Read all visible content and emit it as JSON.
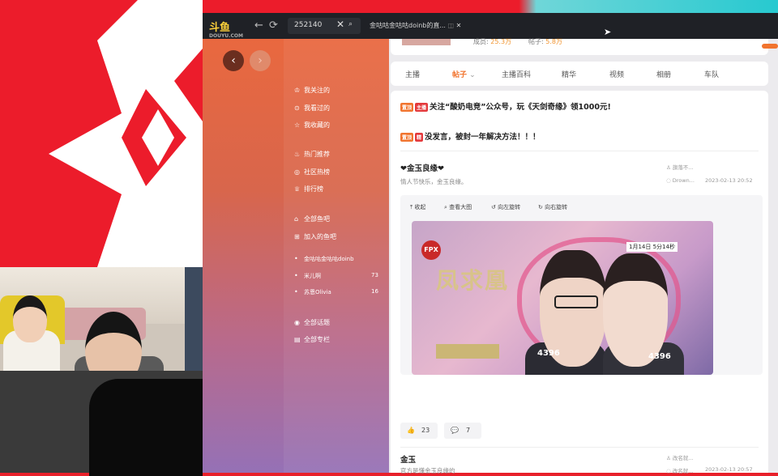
{
  "titlebar": {
    "logo": "斗鱼",
    "logo_sub": "DOUYU.COM",
    "back_icon": "←",
    "reload_icon": "⟳",
    "search_value": "252140",
    "clear_icon": "✕",
    "search_icon": "⌕",
    "tab_title": "金咕咕金咕咕doinb的直...",
    "tab_close_icon": "✕"
  },
  "stats": {
    "fans_label": "成员:",
    "fans_value": "25.3万",
    "posts_label": "帖子:",
    "posts_value": "5.8万"
  },
  "sidebar": {
    "back_arrow": "‹",
    "forward_arrow": "›",
    "items": [
      {
        "icon": "♔",
        "label": "我关注的"
      },
      {
        "icon": "⊙",
        "label": "我看过的"
      },
      {
        "icon": "☆",
        "label": "我收藏的"
      },
      {
        "icon": "♨",
        "label": "热门推荐"
      },
      {
        "icon": "◎",
        "label": "社区热榜"
      },
      {
        "icon": "♕",
        "label": "排行榜"
      },
      {
        "icon": "⌂",
        "label": "全部鱼吧"
      },
      {
        "icon": "⊞",
        "label": "加入的鱼吧"
      },
      {
        "icon": "•",
        "label": "金咕咕金咕咕doinb",
        "count": ""
      },
      {
        "icon": "•",
        "label": "米儿啊",
        "count": "73"
      },
      {
        "icon": "•",
        "label": "苏恩Olivia",
        "count": "16"
      },
      {
        "icon": "◉",
        "label": "全部话题"
      },
      {
        "icon": "▤",
        "label": "全部专栏"
      }
    ]
  },
  "tabs": [
    {
      "label": "主播"
    },
    {
      "label": "帖子"
    },
    {
      "label": "主播百科"
    },
    {
      "label": "精华"
    },
    {
      "label": "视频"
    },
    {
      "label": "相册"
    },
    {
      "label": "车队"
    }
  ],
  "tab_chevron": "⌄",
  "pinned": [
    {
      "badges": [
        "置顶",
        "主播"
      ],
      "title": "关注“酸奶电竞”公众号，玩《天剑奇缘》领1000元!"
    },
    {
      "badges": [
        "置顶",
        "精"
      ],
      "title": "没发言，被封一年解决方法！！！"
    }
  ],
  "post1": {
    "title": "❤金玉良缘❤",
    "subtitle": "情人节快乐，金玉良缘。",
    "author": "旗落不...",
    "replier": "Drown...",
    "time": "2023-02-13 20:52",
    "viewer_tools": [
      {
        "icon": "⤒",
        "label": "收起"
      },
      {
        "icon": "⌕",
        "label": "查看大图"
      },
      {
        "icon": "↺",
        "label": "向左旋转"
      },
      {
        "icon": "↻",
        "label": "向右旋转"
      }
    ],
    "poster": {
      "team": "FPX",
      "title": "凤求凰",
      "date": "1月14日 5分14秒",
      "num_left": "4396",
      "num_right": "4396"
    },
    "like_icon": "👍",
    "likes": "23",
    "comment_icon": "💬",
    "comments": "7"
  },
  "post2": {
    "title": "金玉",
    "subtitle": "官方是懂金玉良缘的",
    "author": "改名就...",
    "replier": "改名就...",
    "time": "2023-02-13 20:57"
  },
  "colors": {
    "accent": "#f1742e",
    "badge_red": "#e4393c",
    "titlebar": "#1f2126"
  }
}
